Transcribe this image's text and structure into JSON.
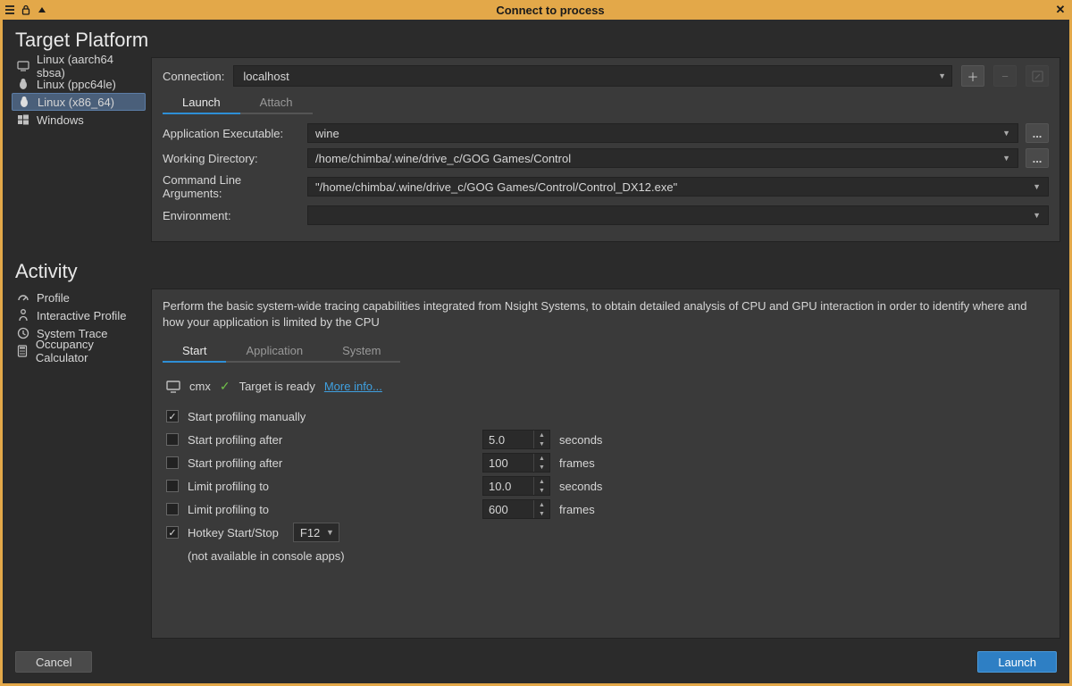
{
  "window": {
    "title": "Connect to process"
  },
  "sections": {
    "target_platform": "Target Platform",
    "activity": "Activity"
  },
  "platforms": [
    {
      "label": "Linux (aarch64 sbsa)",
      "icon": "monitor",
      "selected": false
    },
    {
      "label": "Linux (ppc64le)",
      "icon": "penguin",
      "selected": false
    },
    {
      "label": "Linux (x86_64)",
      "icon": "penguin",
      "selected": true
    },
    {
      "label": "Windows",
      "icon": "windows",
      "selected": false
    }
  ],
  "connection": {
    "label": "Connection:",
    "value": "localhost"
  },
  "target_tabs": {
    "launch": "Launch",
    "attach": "Attach",
    "active": "launch"
  },
  "form": {
    "executable_label": "Application Executable:",
    "executable_value": "wine",
    "wd_label": "Working Directory:",
    "wd_value": "/home/chimba/.wine/drive_c/GOG Games/Control",
    "args_label": "Command Line Arguments:",
    "args_value": "\"/home/chimba/.wine/drive_c/GOG Games/Control/Control_DX12.exe\"",
    "env_label": "Environment:",
    "env_value": ""
  },
  "activities": [
    {
      "label": "Profile",
      "icon": "gauge"
    },
    {
      "label": "Interactive Profile",
      "icon": "person"
    },
    {
      "label": "System Trace",
      "icon": "clock",
      "selected": true
    },
    {
      "label": "Occupancy Calculator",
      "icon": "calc"
    }
  ],
  "activity_desc": "Perform the basic system-wide tracing capabilities integrated from Nsight Systems, to obtain detailed analysis of CPU and GPU interaction in order to identify where and how your application is limited by the CPU",
  "activity_tabs": {
    "start": "Start",
    "application": "Application",
    "system": "System",
    "active": "start"
  },
  "status": {
    "host": "cmx",
    "text": "Target is ready",
    "more": "More info..."
  },
  "options": {
    "manual": {
      "label": "Start profiling manually",
      "checked": true
    },
    "after_sec": {
      "label": "Start profiling after",
      "checked": false,
      "value": "5.0",
      "unit": "seconds"
    },
    "after_frames": {
      "label": "Start profiling after",
      "checked": false,
      "value": "100",
      "unit": "frames"
    },
    "limit_sec": {
      "label": "Limit profiling to",
      "checked": false,
      "value": "10.0",
      "unit": "seconds"
    },
    "limit_frames": {
      "label": "Limit profiling to",
      "checked": false,
      "value": "600",
      "unit": "frames"
    },
    "hotkey": {
      "label": "Hotkey Start/Stop",
      "checked": true,
      "key": "F12"
    },
    "note": "(not available in console apps)"
  },
  "footer": {
    "cancel": "Cancel",
    "launch": "Launch"
  }
}
